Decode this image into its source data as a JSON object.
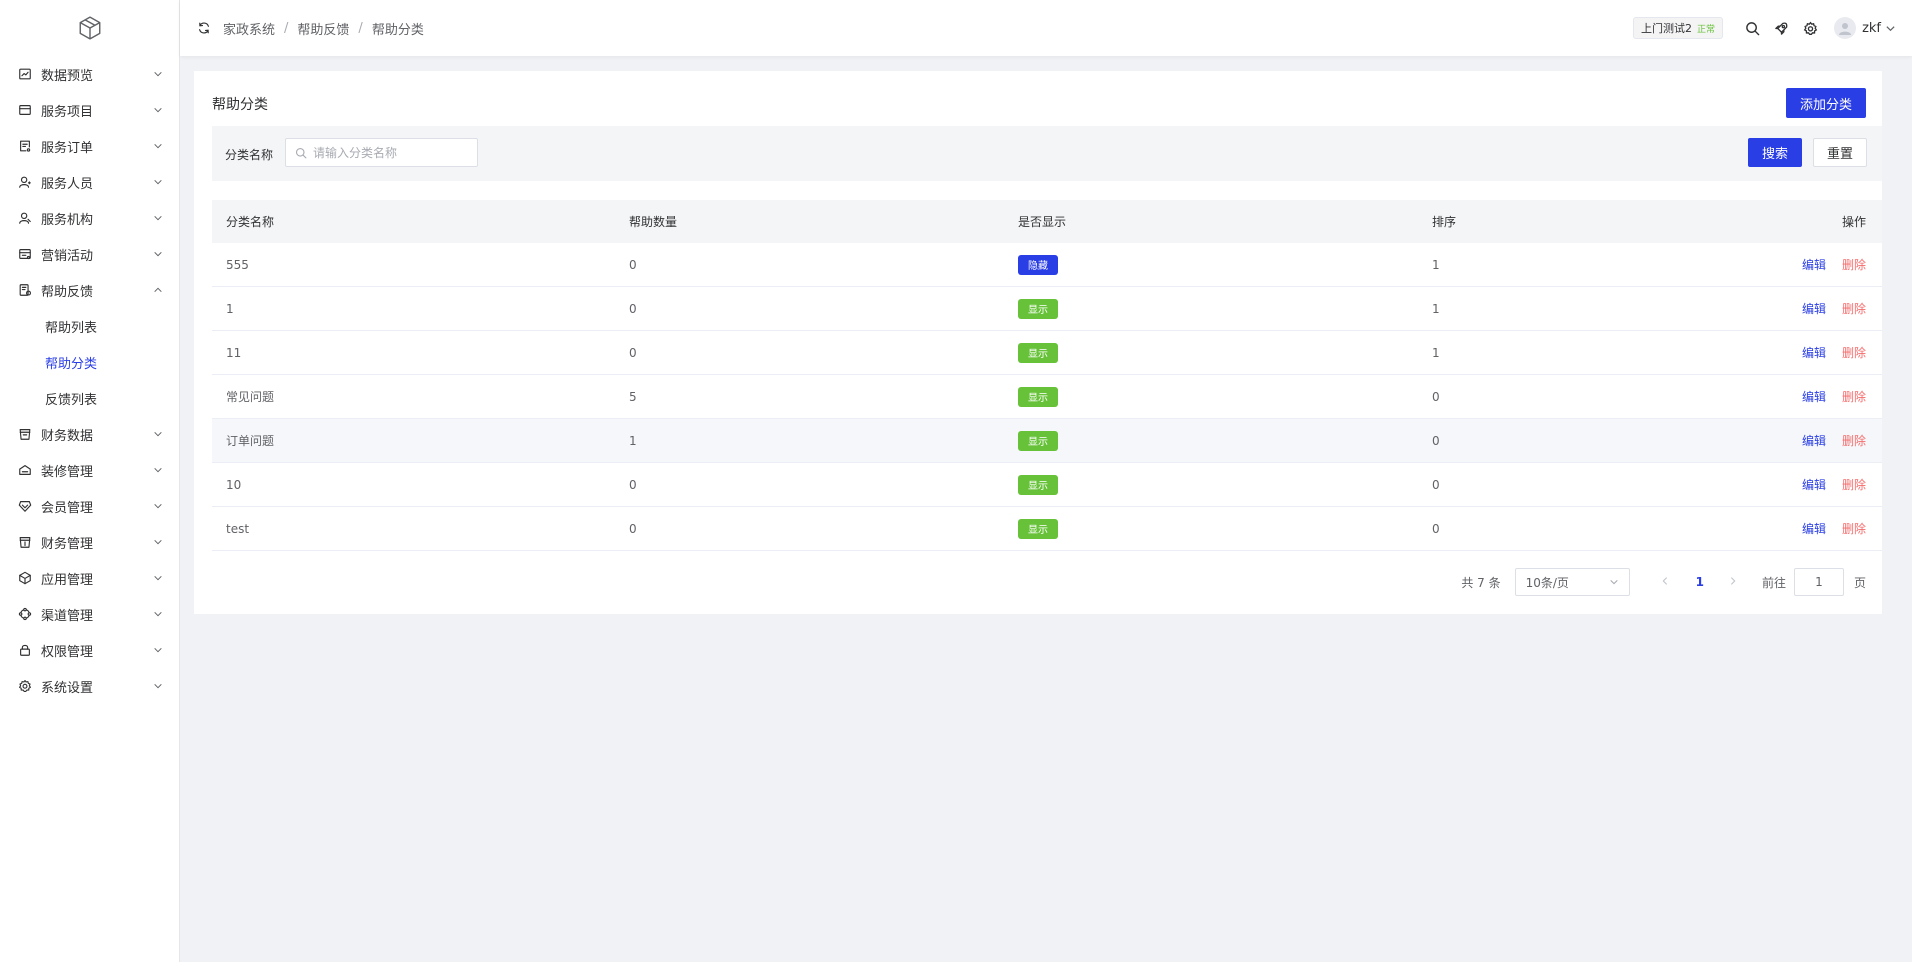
{
  "sidebar": {
    "logo": "cube-logo",
    "items": [
      {
        "label": "数据预览",
        "icon": "chart-icon"
      },
      {
        "label": "服务项目",
        "icon": "card-icon"
      },
      {
        "label": "服务订单",
        "icon": "order-icon"
      },
      {
        "label": "服务人员",
        "icon": "user-icon"
      },
      {
        "label": "服务机构",
        "icon": "org-icon"
      },
      {
        "label": "营销活动",
        "icon": "marketing-icon"
      },
      {
        "label": "帮助反馈",
        "icon": "help-icon",
        "expanded": true,
        "children": [
          {
            "label": "帮助列表"
          },
          {
            "label": "帮助分类",
            "active": true
          },
          {
            "label": "反馈列表"
          }
        ]
      },
      {
        "label": "财务数据",
        "icon": "finance-data-icon"
      },
      {
        "label": "装修管理",
        "icon": "decor-icon"
      },
      {
        "label": "会员管理",
        "icon": "member-icon"
      },
      {
        "label": "财务管理",
        "icon": "finance-icon"
      },
      {
        "label": "应用管理",
        "icon": "app-icon"
      },
      {
        "label": "渠道管理",
        "icon": "channel-icon"
      },
      {
        "label": "权限管理",
        "icon": "lock-icon"
      },
      {
        "label": "系统设置",
        "icon": "settings-icon"
      }
    ]
  },
  "header": {
    "breadcrumb": [
      "家政系统",
      "帮助反馈",
      "帮助分类"
    ],
    "shop_name": "上门测试2",
    "shop_status": "正常",
    "user_name": "zkf"
  },
  "page": {
    "title": "帮助分类",
    "add_button": "添加分类"
  },
  "filter": {
    "label": "分类名称",
    "placeholder": "请输入分类名称",
    "search_button": "搜索",
    "reset_button": "重置"
  },
  "table": {
    "columns": [
      "分类名称",
      "帮助数量",
      "是否显示",
      "排序",
      "操作"
    ],
    "rows": [
      {
        "name": "555",
        "count": "0",
        "visible": "隐藏",
        "sort": "1"
      },
      {
        "name": "1",
        "count": "0",
        "visible": "显示",
        "sort": "1"
      },
      {
        "name": "11",
        "count": "0",
        "visible": "显示",
        "sort": "1"
      },
      {
        "name": "常见问题",
        "count": "5",
        "visible": "显示",
        "sort": "0"
      },
      {
        "name": "订单问题",
        "count": "1",
        "visible": "显示",
        "sort": "0"
      },
      {
        "name": "10",
        "count": "0",
        "visible": "显示",
        "sort": "0"
      },
      {
        "name": "test",
        "count": "0",
        "visible": "显示",
        "sort": "0"
      }
    ],
    "edit_label": "编辑",
    "delete_label": "删除"
  },
  "pagination": {
    "total": "共 7 条",
    "page_size": "10条/页",
    "current_page": "1",
    "goto_label": "前往",
    "goto_value": "1",
    "page_suffix": "页"
  },
  "colors": {
    "primary": "#2a3ee6",
    "success": "#67c23a",
    "danger": "#f56c6c"
  }
}
